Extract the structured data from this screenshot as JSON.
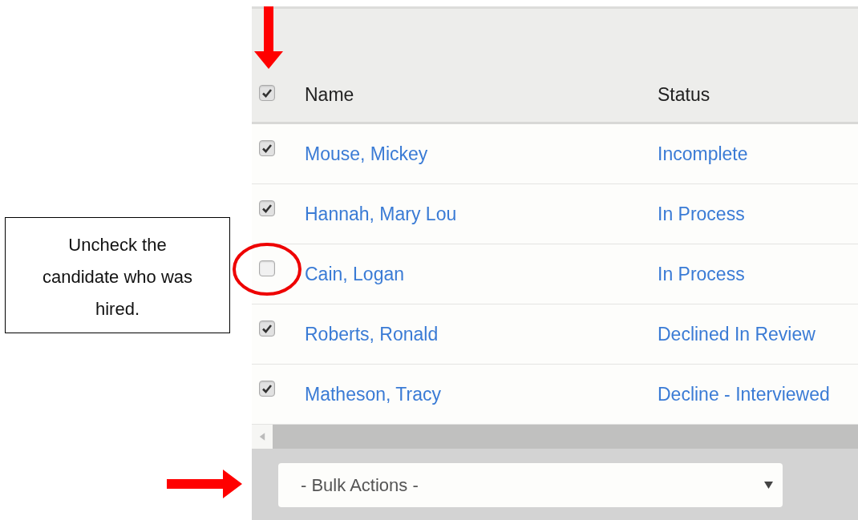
{
  "annotation": {
    "callout": "Uncheck the candidate who was hired."
  },
  "table": {
    "select_all": {
      "checked": true
    },
    "columns": [
      "Name",
      "Status"
    ],
    "rows": [
      {
        "name": "Mouse, Mickey",
        "status": "Incomplete",
        "checked": true
      },
      {
        "name": "Hannah, Mary Lou",
        "status": "In Process",
        "checked": true
      },
      {
        "name": "Cain, Logan",
        "status": "In Process",
        "checked": false
      },
      {
        "name": "Roberts, Ronald",
        "status": "Declined In Review",
        "checked": true
      },
      {
        "name": "Matheson, Tracy",
        "status": "Decline - Interviewed",
        "checked": true
      }
    ]
  },
  "bulk_actions": {
    "value": "- Bulk Actions -"
  }
}
